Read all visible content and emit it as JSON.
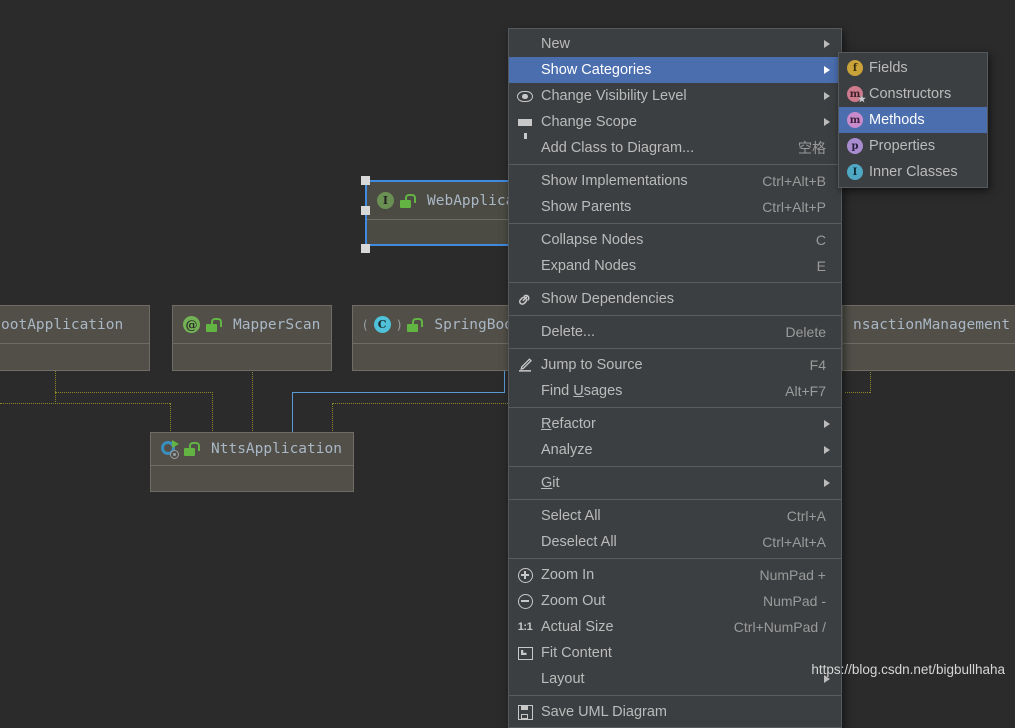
{
  "diagram": {
    "nodes": [
      {
        "id": "springbootapp",
        "label": "ootApplication",
        "icon": "annotation-at-icon",
        "lock": "unlock-icon",
        "selected": false
      },
      {
        "id": "mapperscan",
        "label": "MapperScan",
        "icon": "annotation-at-icon",
        "lock": "unlock-icon",
        "selected": false
      },
      {
        "id": "springbootserv",
        "label": "SpringBootSe",
        "icon": "class-c-icon",
        "lock": "unlock-icon",
        "selected": false
      },
      {
        "id": "transactionmanagement",
        "label": "nsactionManagement",
        "icon": "none",
        "lock": "none",
        "selected": false
      },
      {
        "id": "webapplication",
        "label": "WebApplica",
        "icon": "interface-i-icon",
        "lock": "unlock-icon",
        "selected": true
      },
      {
        "id": "nttsapplication",
        "label": "NttsApplication",
        "icon": "spring-boot-icon",
        "lock": "unlock-icon",
        "selected": false
      }
    ]
  },
  "context_menu": {
    "items": [
      {
        "label": "New",
        "shortcut": "",
        "icon": "none",
        "arrow": true,
        "selected": false,
        "separator_after": false
      },
      {
        "label": "Show Categories",
        "shortcut": "",
        "icon": "none",
        "arrow": true,
        "selected": true,
        "separator_after": false
      },
      {
        "label": "Change Visibility Level",
        "shortcut": "",
        "icon": "eye-icon",
        "arrow": true,
        "selected": false,
        "separator_after": false
      },
      {
        "label": "Change Scope",
        "shortcut": "",
        "icon": "funnel-icon",
        "arrow": true,
        "selected": false,
        "separator_after": false
      },
      {
        "label": "Add Class to Diagram...",
        "shortcut": "空格",
        "icon": "none",
        "arrow": false,
        "selected": false,
        "separator_after": true
      },
      {
        "label": "Show Implementations",
        "shortcut": "Ctrl+Alt+B",
        "icon": "none",
        "arrow": false,
        "selected": false,
        "separator_after": false
      },
      {
        "label": "Show Parents",
        "shortcut": "Ctrl+Alt+P",
        "icon": "none",
        "arrow": false,
        "selected": false,
        "separator_after": true
      },
      {
        "label": "Collapse Nodes",
        "shortcut": "C",
        "icon": "none",
        "arrow": false,
        "selected": false,
        "separator_after": false
      },
      {
        "label": "Expand Nodes",
        "shortcut": "E",
        "icon": "none",
        "arrow": false,
        "selected": false,
        "separator_after": true
      },
      {
        "label": "Show Dependencies",
        "shortcut": "",
        "icon": "link-icon",
        "arrow": false,
        "selected": false,
        "separator_after": true
      },
      {
        "label": "Delete...",
        "shortcut": "Delete",
        "icon": "none",
        "arrow": false,
        "selected": false,
        "separator_after": true
      },
      {
        "label": "Jump to Source",
        "shortcut": "F4",
        "icon": "pencil-icon",
        "arrow": false,
        "selected": false,
        "separator_after": false
      },
      {
        "label": "Find Usages",
        "shortcut": "Alt+F7",
        "icon": "none",
        "arrow": false,
        "selected": false,
        "separator_after": true,
        "mnemonic": "U"
      },
      {
        "label": "Refactor",
        "shortcut": "",
        "icon": "none",
        "arrow": true,
        "selected": false,
        "separator_after": false,
        "mnemonic": "R"
      },
      {
        "label": "Analyze",
        "shortcut": "",
        "icon": "none",
        "arrow": true,
        "selected": false,
        "separator_after": true
      },
      {
        "label": "Git",
        "shortcut": "",
        "icon": "none",
        "arrow": true,
        "selected": false,
        "separator_after": true,
        "mnemonic": "G"
      },
      {
        "label": "Select All",
        "shortcut": "Ctrl+A",
        "icon": "none",
        "arrow": false,
        "selected": false,
        "separator_after": false
      },
      {
        "label": "Deselect All",
        "shortcut": "Ctrl+Alt+A",
        "icon": "none",
        "arrow": false,
        "selected": false,
        "separator_after": true
      },
      {
        "label": "Zoom In",
        "shortcut": "NumPad +",
        "icon": "zoom-in-icon",
        "arrow": false,
        "selected": false,
        "separator_after": false
      },
      {
        "label": "Zoom Out",
        "shortcut": "NumPad -",
        "icon": "zoom-out-icon",
        "arrow": false,
        "selected": false,
        "separator_after": false
      },
      {
        "label": "Actual Size",
        "shortcut": "Ctrl+NumPad /",
        "icon": "one-to-one-icon",
        "arrow": false,
        "selected": false,
        "separator_after": false
      },
      {
        "label": "Fit Content",
        "shortcut": "",
        "icon": "fit-content-icon",
        "arrow": false,
        "selected": false,
        "separator_after": false
      },
      {
        "label": "Layout",
        "shortcut": "",
        "icon": "none",
        "arrow": true,
        "selected": false,
        "separator_after": true
      },
      {
        "label": "Save UML Diagram",
        "shortcut": "",
        "icon": "save-icon",
        "arrow": false,
        "selected": false,
        "separator_after": false
      }
    ]
  },
  "submenu": {
    "items": [
      {
        "label": "Fields",
        "icon": "field-badge-icon",
        "selected": false
      },
      {
        "label": "Constructors",
        "icon": "constructor-badge-icon",
        "selected": false
      },
      {
        "label": "Methods",
        "icon": "method-badge-icon",
        "selected": true
      },
      {
        "label": "Properties",
        "icon": "property-badge-icon",
        "selected": false
      },
      {
        "label": "Inner Classes",
        "icon": "inner-class-badge-icon",
        "selected": false
      }
    ]
  },
  "watermark": {
    "text": "https://blog.csdn.net/bigbullhaha"
  },
  "colors": {
    "background": "#2b2b2b",
    "menu_bg": "#3c3f41",
    "menu_border": "#565a5c",
    "highlight": "#4b6eaf",
    "node_fill": "#514f47",
    "node_border": "#6e6c64",
    "selection_border": "#3f8be0",
    "edge_dotted": "#8a8a2a",
    "edge_selected": "#5b9bd5",
    "text": "#bbbbbb",
    "node_text": "#a9b7c6"
  }
}
